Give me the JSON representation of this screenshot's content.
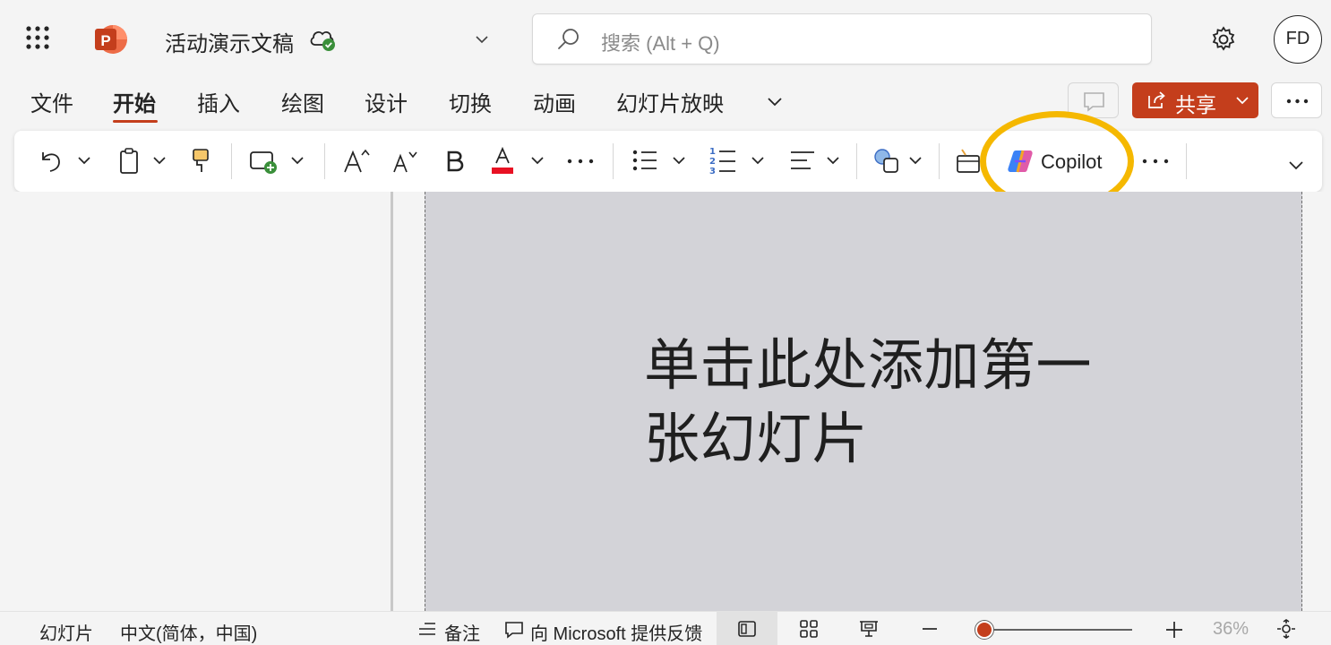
{
  "app": {
    "document_title": "活动演示文稿",
    "avatar_initials": "FD",
    "icons": {
      "app_launcher": "waffle-icon",
      "app_logo": "powerpoint-logo",
      "save_status": "cloud-saved-icon",
      "settings": "gear-icon"
    }
  },
  "search": {
    "placeholder": "搜索 (Alt + Q)"
  },
  "tabs": [
    {
      "label": "文件",
      "active": false
    },
    {
      "label": "开始",
      "active": true
    },
    {
      "label": "插入",
      "active": false
    },
    {
      "label": "绘图",
      "active": false
    },
    {
      "label": "设计",
      "active": false
    },
    {
      "label": "切换",
      "active": false
    },
    {
      "label": "动画",
      "active": false
    },
    {
      "label": "幻灯片放映",
      "active": false
    }
  ],
  "actions": {
    "share_label": "共享"
  },
  "ribbon": {
    "copilot_label": "Copilot",
    "icons": [
      "undo-icon",
      "clipboard-icon",
      "format-painter-icon",
      "new-slide-icon",
      "increase-font-icon",
      "decrease-font-icon",
      "bold-icon",
      "font-color-icon",
      "more-icon",
      "bullets-icon",
      "numbering-icon",
      "align-icon",
      "shapes-icon",
      "designer-icon",
      "copilot-icon",
      "more-icon",
      "expand-ribbon-icon"
    ]
  },
  "slide": {
    "title_line1": "单击此处添加第一",
    "title_line2": "张幻灯片"
  },
  "statusbar": {
    "slide_label": "幻灯片",
    "language": "中文(简体，中国)",
    "notes_label": "备注",
    "feedback_label": "向 Microsoft 提供反馈",
    "zoom_percent": "36%",
    "zoom_level": 0.36
  },
  "colors": {
    "accent": "#c43e1c",
    "highlight": "#f5b800",
    "slide_background": "#d3d3d8"
  }
}
